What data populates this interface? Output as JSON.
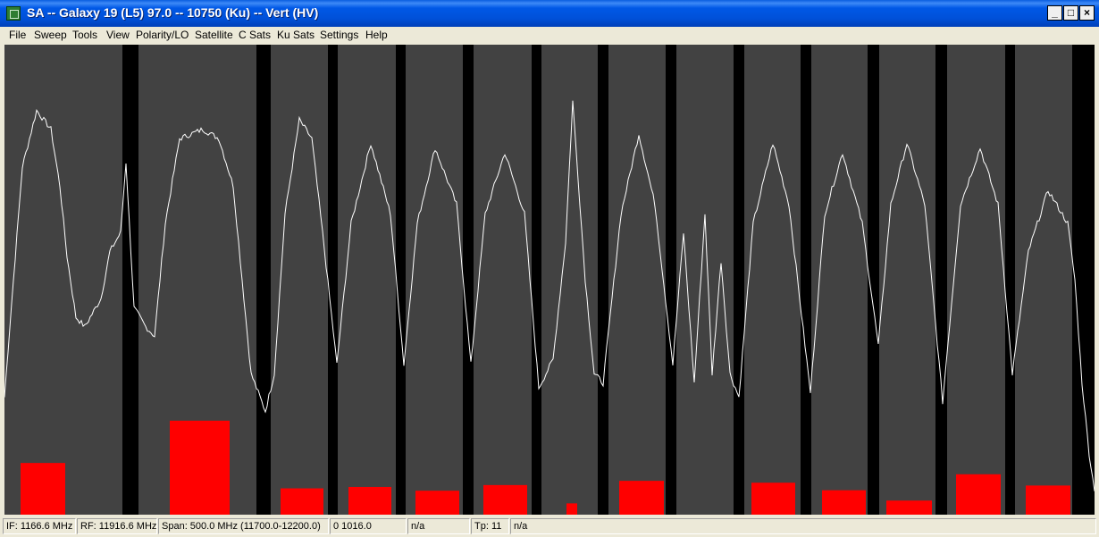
{
  "window": {
    "title": "SA -- Galaxy 19 (L5) 97.0 -- 10750 (Ku) -- Vert (HV)",
    "minimize_glyph": "_",
    "maximize_glyph": "□",
    "close_glyph": "×"
  },
  "menu": [
    "File",
    "Sweep",
    "Tools",
    "View",
    "Polarity/LO",
    "Satellite",
    "C Sats",
    "Ku Sats",
    "Settings",
    "Help"
  ],
  "status": {
    "if": "IF: 1166.6 MHz",
    "rf": "RF: 11916.6 MHz",
    "span": "Span: 500.0 MHz (11700.0-12200.0)",
    "val": "0 1016.0",
    "na1": "n/a",
    "tp": "Tp: 11",
    "na2": "n/a"
  },
  "chart_data": {
    "type": "line",
    "colors": {
      "background": "#000000",
      "band": "#424242",
      "trace": "#ffffff",
      "bar": "#ff0000"
    },
    "trace": [
      [
        0,
        0.25
      ],
      [
        8,
        0.45
      ],
      [
        20,
        0.74
      ],
      [
        36,
        0.86
      ],
      [
        52,
        0.82
      ],
      [
        62,
        0.7
      ],
      [
        70,
        0.55
      ],
      [
        80,
        0.42
      ],
      [
        90,
        0.4
      ],
      [
        108,
        0.46
      ],
      [
        118,
        0.56
      ],
      [
        130,
        0.6
      ],
      [
        136,
        0.75
      ],
      [
        145,
        0.44
      ],
      [
        158,
        0.4
      ],
      [
        168,
        0.38
      ],
      [
        180,
        0.62
      ],
      [
        196,
        0.8
      ],
      [
        222,
        0.82
      ],
      [
        240,
        0.8
      ],
      [
        256,
        0.7
      ],
      [
        266,
        0.5
      ],
      [
        276,
        0.3
      ],
      [
        292,
        0.22
      ],
      [
        302,
        0.3
      ],
      [
        314,
        0.64
      ],
      [
        330,
        0.84
      ],
      [
        344,
        0.8
      ],
      [
        356,
        0.6
      ],
      [
        372,
        0.32
      ],
      [
        388,
        0.62
      ],
      [
        410,
        0.79
      ],
      [
        432,
        0.64
      ],
      [
        447,
        0.32
      ],
      [
        462,
        0.62
      ],
      [
        482,
        0.78
      ],
      [
        506,
        0.66
      ],
      [
        522,
        0.32
      ],
      [
        538,
        0.64
      ],
      [
        560,
        0.77
      ],
      [
        582,
        0.64
      ],
      [
        598,
        0.27
      ],
      [
        614,
        0.33
      ],
      [
        628,
        0.58
      ],
      [
        636,
        0.88
      ],
      [
        650,
        0.5
      ],
      [
        660,
        0.3
      ],
      [
        670,
        0.28
      ],
      [
        690,
        0.64
      ],
      [
        710,
        0.81
      ],
      [
        728,
        0.66
      ],
      [
        748,
        0.32
      ],
      [
        760,
        0.6
      ],
      [
        772,
        0.28
      ],
      [
        784,
        0.64
      ],
      [
        792,
        0.3
      ],
      [
        802,
        0.54
      ],
      [
        812,
        0.3
      ],
      [
        822,
        0.25
      ],
      [
        838,
        0.62
      ],
      [
        860,
        0.79
      ],
      [
        878,
        0.66
      ],
      [
        902,
        0.26
      ],
      [
        918,
        0.64
      ],
      [
        938,
        0.77
      ],
      [
        960,
        0.62
      ],
      [
        978,
        0.36
      ],
      [
        992,
        0.66
      ],
      [
        1010,
        0.79
      ],
      [
        1030,
        0.66
      ],
      [
        1050,
        0.24
      ],
      [
        1070,
        0.66
      ],
      [
        1092,
        0.78
      ],
      [
        1112,
        0.66
      ],
      [
        1128,
        0.3
      ],
      [
        1146,
        0.56
      ],
      [
        1168,
        0.69
      ],
      [
        1190,
        0.62
      ],
      [
        1198,
        0.5
      ],
      [
        1206,
        0.28
      ],
      [
        1214,
        0.13
      ],
      [
        1220,
        0.05
      ]
    ],
    "bands": [
      [
        0,
        132
      ],
      [
        150,
        282
      ],
      [
        298,
        362
      ],
      [
        373,
        438
      ],
      [
        449,
        513
      ],
      [
        525,
        590
      ],
      [
        601,
        664
      ],
      [
        676,
        740
      ],
      [
        752,
        816
      ],
      [
        828,
        891
      ],
      [
        903,
        966
      ],
      [
        979,
        1042
      ],
      [
        1055,
        1120
      ],
      [
        1131,
        1195
      ]
    ],
    "bars": [
      [
        18,
        68,
        0.11
      ],
      [
        185,
        252,
        0.2
      ],
      [
        309,
        357,
        0.056
      ],
      [
        385,
        433,
        0.059
      ],
      [
        460,
        509,
        0.051
      ],
      [
        536,
        585,
        0.063
      ],
      [
        629,
        641,
        0.024
      ],
      [
        688,
        738,
        0.072
      ],
      [
        836,
        885,
        0.068
      ],
      [
        915,
        964,
        0.052
      ],
      [
        987,
        1038,
        0.03
      ],
      [
        1065,
        1115,
        0.086
      ],
      [
        1143,
        1193,
        0.062
      ]
    ]
  }
}
